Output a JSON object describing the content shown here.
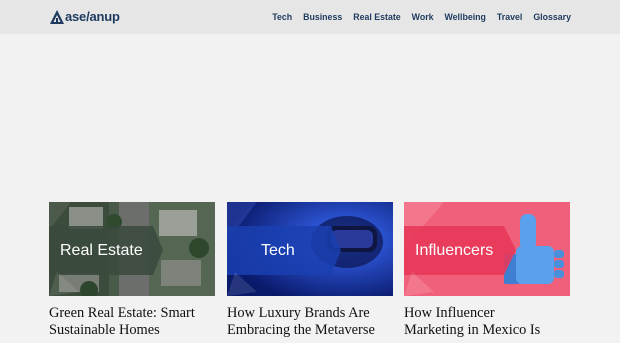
{
  "header": {
    "logo_text": "ase/anup",
    "nav": [
      "Tech",
      "Business",
      "Real Estate",
      "Work",
      "Wellbeing",
      "Travel",
      "Glossary"
    ]
  },
  "cards": [
    {
      "category": "Real Estate",
      "title_lines": [
        "Green Real Estate: Smart",
        "Sustainable Homes"
      ],
      "photo_icon": "aerial-homes-photo",
      "accent": "#3a4a3e"
    },
    {
      "category": "Tech",
      "title_lines": [
        "How Luxury Brands Are",
        "Embracing the Metaverse"
      ],
      "photo_icon": "vr-headset-photo",
      "accent": "#1a3fb0"
    },
    {
      "category": "Influencers",
      "title_lines": [
        "How Influencer",
        "Marketing in Mexico Is"
      ],
      "photo_icon": "thumbs-up-photo",
      "accent": "#e8385a"
    }
  ]
}
